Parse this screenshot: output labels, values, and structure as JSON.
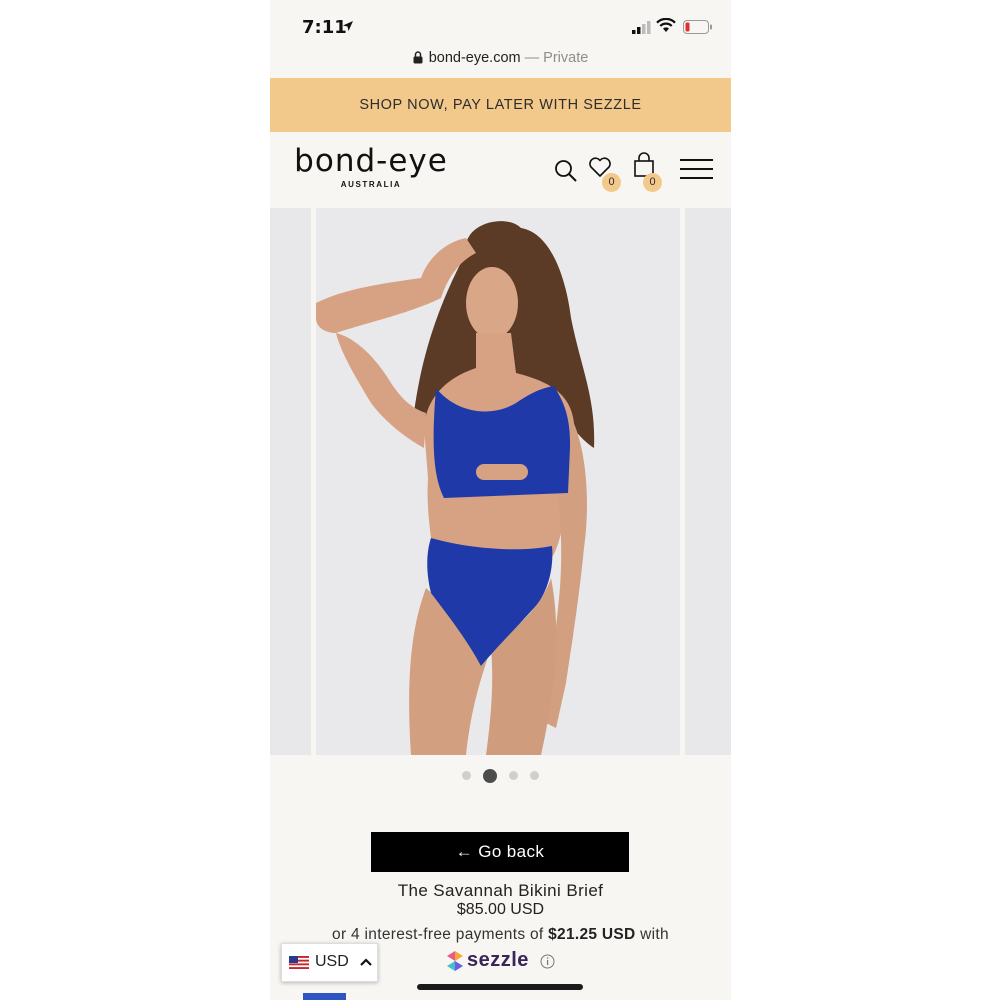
{
  "status_bar": {
    "time": "7:11"
  },
  "browser": {
    "url": "bond-eye.com",
    "private_label": "— Private"
  },
  "promo": {
    "text": "SHOP NOW, PAY LATER WITH SEZZLE",
    "background": "#f2c98b"
  },
  "header": {
    "logo": "bond-eye",
    "logo_sub": "AUSTRALIA",
    "wishlist_count": "0",
    "cart_count": "0",
    "icons": [
      "search-icon",
      "heart-icon",
      "bag-icon",
      "hamburger-menu-icon"
    ]
  },
  "carousel": {
    "slide_count": 4,
    "active_index": 1,
    "swimsuit_color": "#1f3aa8"
  },
  "product": {
    "back_label": "← Go back",
    "name": "The Savannah Bikini Brief",
    "price": "$85.00 USD",
    "installments_prefix": "or 4 interest-free payments of ",
    "installment_amount": "$21.25 USD",
    "installments_suffix": " with",
    "provider": "sezzle",
    "provider_color": "#392558"
  },
  "currency": {
    "code": "USD"
  }
}
